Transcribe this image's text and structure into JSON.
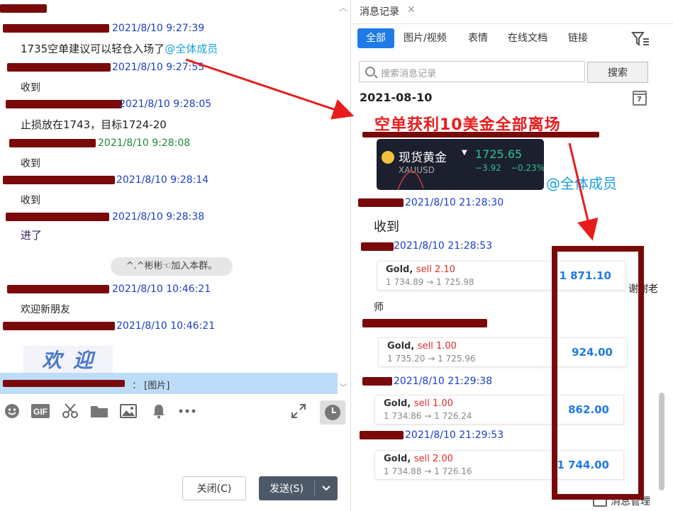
{
  "left_chat": {
    "messages": [
      {
        "time": "2021/8/10 9:27:39",
        "text": "1735空单建议可以轻仓入场了",
        "mention": "@全体成员"
      },
      {
        "time": "2021/8/10 9:27:55",
        "text": "收到"
      },
      {
        "time": "2021/8/10 9:28:05",
        "text": "止损放在1743，目标1724-20"
      },
      {
        "time": "2021/8/10 9:28:08",
        "text": "收到"
      },
      {
        "time": "2021/8/10 9:28:14",
        "text": "收到"
      },
      {
        "time": "2021/8/10 9:28:38",
        "text": "进了"
      },
      {
        "time": "2021/8/10 10:46:21",
        "text": "欢迎新朋友"
      },
      {
        "time": "2021/8/10 10:46:21"
      }
    ],
    "system_notice": "^.^彬彬☜加入本群。",
    "welcome_image_text": [
      "欢",
      "迎"
    ],
    "notice_bar_text": "：  [图片]",
    "toolbar_icons": [
      "emoji-icon",
      "gif-icon",
      "scissors-icon",
      "folder-icon",
      "image-icon",
      "bell-icon",
      "more-icon",
      "expand-icon"
    ],
    "toolbar_gif_label": "GIF",
    "close_button": "关闭(C)",
    "send_button": "发送(S)",
    "scroll_up": "︿",
    "scroll_down": "﹀"
  },
  "history": {
    "tab_title": "消息记录",
    "tab_close": "✕",
    "filters": [
      "全部",
      "图片/视频",
      "表情",
      "在线文档",
      "链接"
    ],
    "active_filter": "全部",
    "search_placeholder": "搜索消息记录",
    "search_button": "搜索",
    "date": "2021-08-10",
    "calendar_day": "7",
    "headline": "空单获利10美金全部离场",
    "quote": {
      "name": "现货黄金",
      "code": "XAUUSD",
      "price": "1725.65",
      "change": "−3.92",
      "change_pct": "−0.23%"
    },
    "mention": "@全体成员",
    "msg1": {
      "time": "2021/8/10 21:28:30",
      "text": "收到"
    },
    "msg2": {
      "time": "2021/8/10 21:28:53"
    },
    "msg2_text": "谢谢老",
    "msg2_text_wrap": "师",
    "msg4": {
      "time": "2021/8/10 21:29:38"
    },
    "msg5": {
      "time": "2021/8/10 21:29:53"
    },
    "trades": [
      {
        "asset": "Gold,",
        "side": "sell 2.10",
        "path": "1 734.89 → 1 725.98",
        "profit": "1 871.10"
      },
      {
        "asset": "Gold,",
        "side": "sell 1.00",
        "path": "1 735.20 → 1 725.96",
        "profit": "924.00"
      },
      {
        "asset": "Gold,",
        "side": "sell 1.00",
        "path": "1 734.86 → 1 726.24",
        "profit": "862.00"
      },
      {
        "asset": "Gold,",
        "side": "sell 2.00",
        "path": "1 734.88 → 1 726.16",
        "profit": "1 744.00"
      }
    ],
    "footer": "消息管理"
  },
  "colors": {
    "accent_blue": "#1f7ae8",
    "redaction": "#7a0a0a",
    "annotation_red": "#e81c1c",
    "price_green": "#2fc28f"
  }
}
